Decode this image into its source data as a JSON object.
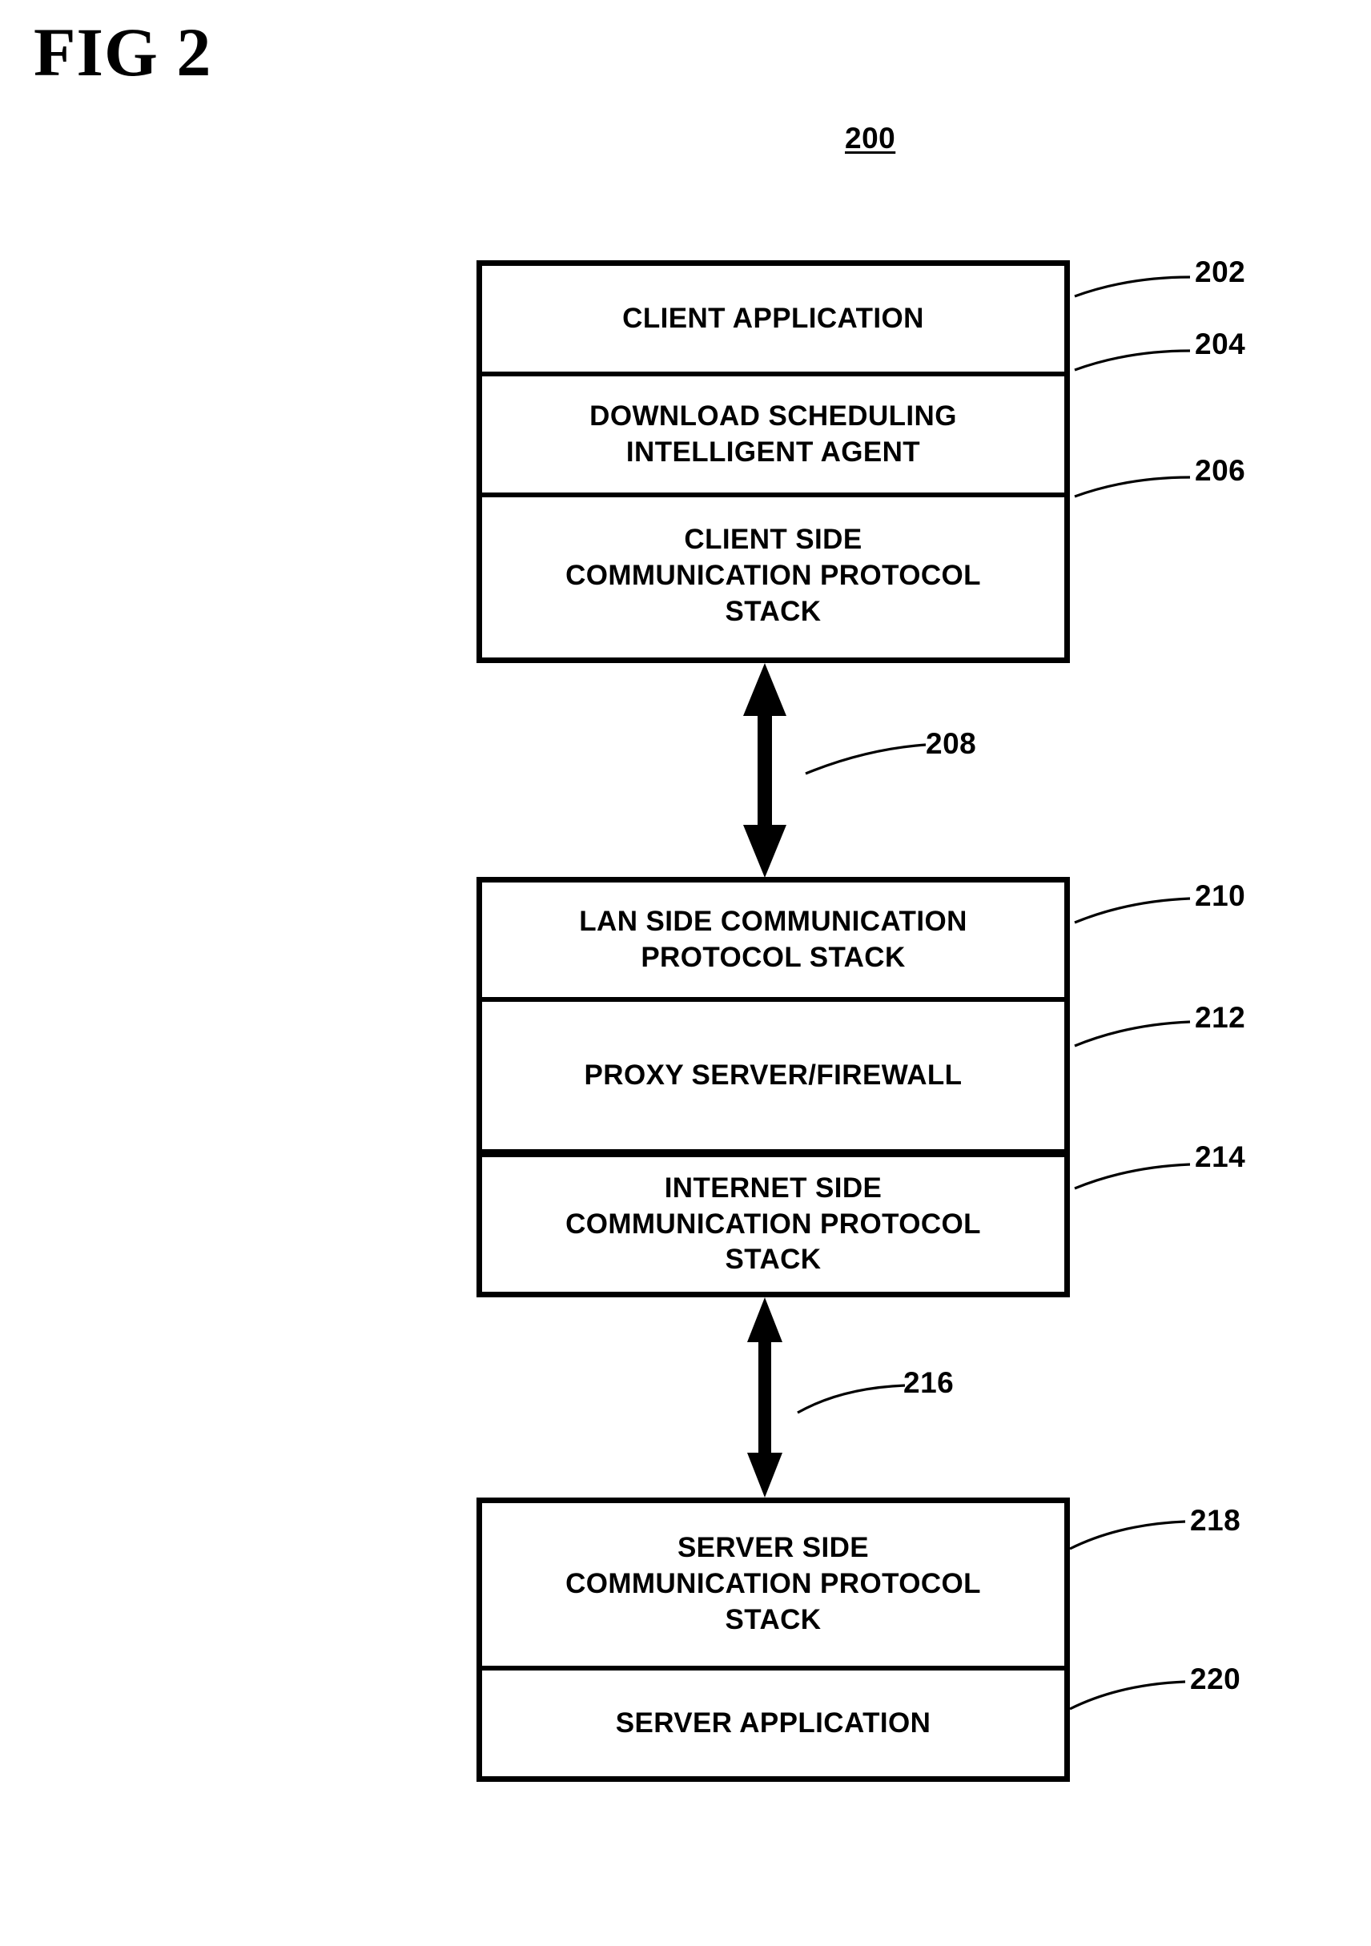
{
  "figure": {
    "title": "FIG 2",
    "ref": "200"
  },
  "groups": [
    {
      "name": "client-group",
      "cells": [
        {
          "label": "CLIENT APPLICATION",
          "ref": "202"
        },
        {
          "label": "DOWNLOAD SCHEDULING\nINTELLIGENT AGENT",
          "ref": "204"
        },
        {
          "label": "CLIENT SIDE\nCOMMUNICATION PROTOCOL\nSTACK",
          "ref": "206"
        }
      ]
    },
    {
      "name": "proxy-group",
      "cells": [
        {
          "label": "LAN SIDE COMMUNICATION\nPROTOCOL STACK",
          "ref": "210"
        },
        {
          "label": "PROXY SERVER/FIREWALL",
          "ref": "212"
        },
        {
          "label": "INTERNET SIDE\nCOMMUNICATION PROTOCOL\nSTACK",
          "ref": "214"
        }
      ]
    },
    {
      "name": "server-group",
      "cells": [
        {
          "label": "SERVER SIDE\nCOMMUNICATION PROTOCOL\nSTACK",
          "ref": "218"
        },
        {
          "label": "SERVER APPLICATION",
          "ref": "220"
        }
      ]
    }
  ],
  "connectors": [
    {
      "name": "client-to-proxy-link",
      "ref": "208"
    },
    {
      "name": "proxy-to-server-link",
      "ref": "216"
    }
  ],
  "colors": {
    "stroke": "#000000",
    "background": "#ffffff"
  }
}
